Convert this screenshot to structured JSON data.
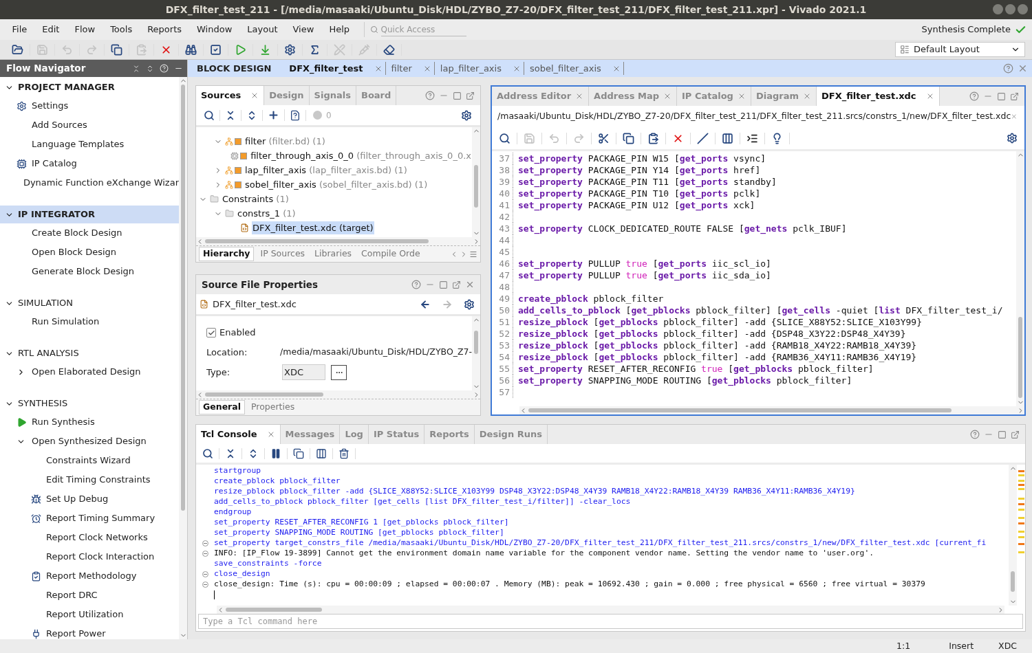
{
  "window": {
    "title": "DFX_filter_test_211 - [/media/masaaki/Ubuntu_Disk/HDL/ZYBO_Z7-20/DFX_filter_test_211/DFX_filter_test_211.xpr] - Vivado 2021.1"
  },
  "menu": [
    "File",
    "Edit",
    "Flow",
    "Tools",
    "Reports",
    "Window",
    "Layout",
    "View",
    "Help"
  ],
  "quick_access": {
    "placeholder": "Quick Access"
  },
  "status": {
    "text": "Synthesis Complete"
  },
  "layout_select": {
    "value": "Default Layout"
  },
  "toolbar": [
    {
      "kind": "open",
      "disabled": false
    },
    {
      "kind": "save",
      "disabled": true
    },
    {
      "kind": "undo",
      "disabled": true
    },
    {
      "kind": "redo",
      "disabled": true
    },
    {
      "kind": "copy",
      "disabled": false
    },
    {
      "kind": "paste",
      "disabled": true
    },
    {
      "kind": "delete",
      "disabled": false
    },
    {
      "kind": "find",
      "disabled": false
    },
    {
      "kind": "check",
      "disabled": false
    },
    {
      "kind": "run",
      "disabled": false
    },
    {
      "kind": "program",
      "disabled": false
    },
    {
      "kind": "settings",
      "disabled": false
    },
    {
      "kind": "sigma",
      "disabled": false
    },
    {
      "kind": "mark",
      "disabled": true
    },
    {
      "kind": "probe",
      "disabled": true
    },
    {
      "kind": "unmark",
      "disabled": false
    }
  ],
  "flow_navigator": {
    "title": "Flow Navigator",
    "sections": [
      {
        "label": "PROJECT MANAGER",
        "expanded": true,
        "selected": false,
        "bold": true,
        "items": [
          {
            "label": "Settings",
            "kind": "gear"
          },
          {
            "label": "Add Sources",
            "kind": "plain"
          },
          {
            "label": "Language Templates",
            "kind": "plain"
          },
          {
            "label": "IP Catalog",
            "kind": "ip"
          },
          {
            "label": "Dynamic Function eXchange Wizar",
            "kind": "plain"
          }
        ]
      },
      {
        "label": "IP INTEGRATOR",
        "expanded": true,
        "selected": true,
        "bold": true,
        "items": [
          {
            "label": "Create Block Design",
            "kind": "plain"
          },
          {
            "label": "Open Block Design",
            "kind": "plain"
          },
          {
            "label": "Generate Block Design",
            "kind": "plain"
          }
        ]
      },
      {
        "label": "SIMULATION",
        "expanded": true,
        "selected": false,
        "bold": false,
        "items": [
          {
            "label": "Run Simulation",
            "kind": "plain"
          }
        ]
      },
      {
        "label": "RTL ANALYSIS",
        "expanded": true,
        "selected": false,
        "bold": false,
        "items": [
          {
            "label": "Open Elaborated Design",
            "kind": "plain",
            "expanded": false
          }
        ]
      },
      {
        "label": "SYNTHESIS",
        "expanded": true,
        "selected": false,
        "bold": false,
        "items": [
          {
            "label": "Run Synthesis",
            "kind": "run"
          },
          {
            "label": "Open Synthesized Design",
            "kind": "plain",
            "expanded": true,
            "children": [
              {
                "label": "Constraints Wizard",
                "kind": "plain"
              },
              {
                "label": "Edit Timing Constraints",
                "kind": "plain"
              },
              {
                "label": "Set Up Debug",
                "kind": "debug"
              },
              {
                "label": "Report Timing Summary",
                "kind": "timer"
              },
              {
                "label": "Report Clock Networks",
                "kind": "plain"
              },
              {
                "label": "Report Clock Interaction",
                "kind": "plain"
              },
              {
                "label": "Report Methodology",
                "kind": "checklist"
              },
              {
                "label": "Report DRC",
                "kind": "plain"
              },
              {
                "label": "Report Utilization",
                "kind": "plain"
              },
              {
                "label": "Report Power",
                "kind": "power"
              }
            ]
          }
        ]
      }
    ]
  },
  "document": {
    "label": "BLOCK DESIGN",
    "tabs": [
      {
        "label": "DFX_filter_test",
        "selected": true
      },
      {
        "label": "filter",
        "selected": false
      },
      {
        "label": "lap_filter_axis",
        "selected": false
      },
      {
        "label": "sobel_filter_axis",
        "selected": false
      }
    ]
  },
  "sources": {
    "tabs": [
      {
        "label": "Sources",
        "selected": true
      },
      {
        "label": "Design",
        "selected": false
      },
      {
        "label": "Signals",
        "selected": false
      },
      {
        "label": "Board",
        "selected": false
      }
    ],
    "count": "0",
    "design_items": [
      {
        "name": "filter",
        "detail": "(filter.bd) (1)",
        "kind": "bd",
        "expanded": true,
        "selected": false,
        "children": [
          {
            "name": "filter_through_axis_0_0",
            "detail": "(filter_through_axis_0_0.x",
            "kind": "ip",
            "selected": false
          }
        ]
      },
      {
        "name": "lap_filter_axis",
        "detail": "(lap_filter_axis.bd) (1)",
        "kind": "bd",
        "expanded": false,
        "selected": false
      },
      {
        "name": "sobel_filter_axis",
        "detail": "(sobel_filter_axis.bd) (1)",
        "kind": "bd",
        "expanded": false,
        "selected": false
      }
    ],
    "tree": [
      {
        "name": "Constraints",
        "detail": "(1)",
        "kind": "folder",
        "expanded": true,
        "selected": false,
        "children": [
          {
            "name": "constrs_1",
            "detail": "(1)",
            "kind": "folder",
            "expanded": true,
            "selected": false,
            "children": [
              {
                "name": "DFX_filter_test.xdc (target)",
                "kind": "xdc",
                "selected": true
              }
            ]
          }
        ]
      }
    ],
    "bottom_tabs": [
      {
        "label": "Hierarchy",
        "selected": true
      },
      {
        "label": "IP Sources",
        "selected": false
      },
      {
        "label": "Libraries",
        "selected": false
      },
      {
        "label": "Compile Orde",
        "selected": false
      }
    ]
  },
  "properties": {
    "title": "Source File Properties",
    "file": "DFX_filter_test.xdc",
    "enabled": {
      "label": "Enabled",
      "checked": true
    },
    "location": {
      "label": "Location:",
      "value": "/media/masaaki/Ubuntu_Disk/HDL/ZYBO_Z7-"
    },
    "type": {
      "label": "Type:",
      "value": "XDC"
    },
    "bottom_tabs": [
      {
        "label": "General",
        "selected": true
      },
      {
        "label": "Properties",
        "selected": false
      }
    ]
  },
  "editor": {
    "tabs": [
      {
        "label": "Address Editor",
        "selected": false
      },
      {
        "label": "Address Map",
        "selected": false
      },
      {
        "label": "IP Catalog",
        "selected": false
      },
      {
        "label": "Diagram",
        "selected": false
      },
      {
        "label": "DFX_filter_test.xdc",
        "selected": true
      }
    ],
    "path": "/masaaki/Ubuntu_Disk/HDL/ZYBO_Z7-20/DFX_filter_test_211/DFX_filter_test_211.srcs/constrs_1/new/DFX_filter_test.xdc",
    "toolbar": [
      {
        "kind": "search",
        "disabled": false
      },
      {
        "kind": "save",
        "disabled": true
      },
      {
        "kind": "undo",
        "disabled": true
      },
      {
        "kind": "redo",
        "disabled": true
      },
      {
        "kind": "cut",
        "disabled": false
      },
      {
        "kind": "copy",
        "disabled": false
      },
      {
        "kind": "paste",
        "disabled": false
      },
      {
        "kind": "delete",
        "disabled": false
      },
      {
        "kind": "comment",
        "disabled": false
      },
      {
        "kind": "columns",
        "disabled": false
      },
      {
        "kind": "indent",
        "disabled": false
      },
      {
        "kind": "bulb",
        "disabled": false
      }
    ],
    "lines": [
      {
        "number": "37",
        "tokens": [
          {
            "kind": "keyword",
            "text": "set_property"
          },
          {
            "kind": "plain",
            "text": " PACKAGE_PIN W15 ["
          },
          {
            "kind": "keyword",
            "text": "get_ports"
          },
          {
            "kind": "plain",
            "text": " vsync]"
          }
        ]
      },
      {
        "number": "38",
        "tokens": [
          {
            "kind": "keyword",
            "text": "set_property"
          },
          {
            "kind": "plain",
            "text": " PACKAGE_PIN Y14 ["
          },
          {
            "kind": "keyword",
            "text": "get_ports"
          },
          {
            "kind": "plain",
            "text": " href]"
          }
        ]
      },
      {
        "number": "39",
        "tokens": [
          {
            "kind": "keyword",
            "text": "set_property"
          },
          {
            "kind": "plain",
            "text": " PACKAGE_PIN T11 ["
          },
          {
            "kind": "keyword",
            "text": "get_ports"
          },
          {
            "kind": "plain",
            "text": " standby]"
          }
        ]
      },
      {
        "number": "40",
        "tokens": [
          {
            "kind": "keyword",
            "text": "set_property"
          },
          {
            "kind": "plain",
            "text": " PACKAGE_PIN T10 ["
          },
          {
            "kind": "keyword",
            "text": "get_ports"
          },
          {
            "kind": "plain",
            "text": " pclk]"
          }
        ]
      },
      {
        "number": "41",
        "tokens": [
          {
            "kind": "keyword",
            "text": "set_property"
          },
          {
            "kind": "plain",
            "text": " PACKAGE_PIN U12 ["
          },
          {
            "kind": "keyword",
            "text": "get_ports"
          },
          {
            "kind": "plain",
            "text": " xck]"
          }
        ]
      },
      {
        "number": "42"
      },
      {
        "number": "43",
        "tokens": [
          {
            "kind": "keyword",
            "text": "set_property"
          },
          {
            "kind": "plain",
            "text": " CLOCK_DEDICATED_ROUTE FALSE ["
          },
          {
            "kind": "keyword",
            "text": "get_nets"
          },
          {
            "kind": "plain",
            "text": " pclk_IBUF]"
          }
        ]
      },
      {
        "number": "44"
      },
      {
        "number": "45"
      },
      {
        "number": "46",
        "tokens": [
          {
            "kind": "keyword",
            "text": "set_property"
          },
          {
            "kind": "plain",
            "text": " PULLUP "
          },
          {
            "kind": "literal",
            "text": "true"
          },
          {
            "kind": "plain",
            "text": " ["
          },
          {
            "kind": "keyword",
            "text": "get_ports"
          },
          {
            "kind": "plain",
            "text": " iic_scl_io]"
          }
        ]
      },
      {
        "number": "47",
        "tokens": [
          {
            "kind": "keyword",
            "text": "set_property"
          },
          {
            "kind": "plain",
            "text": " PULLUP "
          },
          {
            "kind": "literal",
            "text": "true"
          },
          {
            "kind": "plain",
            "text": " ["
          },
          {
            "kind": "keyword",
            "text": "get_ports"
          },
          {
            "kind": "plain",
            "text": " iic_sda_io]"
          }
        ]
      },
      {
        "number": "48"
      },
      {
        "number": "49",
        "tokens": [
          {
            "kind": "keyword",
            "text": "create_pblock"
          },
          {
            "kind": "plain",
            "text": " pblock_filter"
          }
        ]
      },
      {
        "number": "50",
        "tokens": [
          {
            "kind": "keyword",
            "text": "add_cells_to_pblock"
          },
          {
            "kind": "plain",
            "text": " ["
          },
          {
            "kind": "keyword",
            "text": "get_pblocks"
          },
          {
            "kind": "plain",
            "text": " pblock_filter] ["
          },
          {
            "kind": "keyword",
            "text": "get_cells"
          },
          {
            "kind": "plain",
            "text": " -quiet ["
          },
          {
            "kind": "keyword",
            "text": "list"
          },
          {
            "kind": "plain",
            "text": " DFX_filter_test_i/"
          }
        ]
      },
      {
        "number": "51",
        "tokens": [
          {
            "kind": "keyword",
            "text": "resize_pblock"
          },
          {
            "kind": "plain",
            "text": " ["
          },
          {
            "kind": "keyword",
            "text": "get_pblocks"
          },
          {
            "kind": "plain",
            "text": " pblock_filter] -add {SLICE_X88Y52:SLICE_X103Y99}"
          }
        ]
      },
      {
        "number": "52",
        "tokens": [
          {
            "kind": "keyword",
            "text": "resize_pblock"
          },
          {
            "kind": "plain",
            "text": " ["
          },
          {
            "kind": "keyword",
            "text": "get_pblocks"
          },
          {
            "kind": "plain",
            "text": " pblock_filter] -add {DSP48_X3Y22:DSP48_X4Y39}"
          }
        ]
      },
      {
        "number": "53",
        "tokens": [
          {
            "kind": "keyword",
            "text": "resize_pblock"
          },
          {
            "kind": "plain",
            "text": " ["
          },
          {
            "kind": "keyword",
            "text": "get_pblocks"
          },
          {
            "kind": "plain",
            "text": " pblock_filter] -add {RAMB18_X4Y22:RAMB18_X4Y39}"
          }
        ]
      },
      {
        "number": "54",
        "tokens": [
          {
            "kind": "keyword",
            "text": "resize_pblock"
          },
          {
            "kind": "plain",
            "text": " ["
          },
          {
            "kind": "keyword",
            "text": "get_pblocks"
          },
          {
            "kind": "plain",
            "text": " pblock_filter] -add {RAMB36_X4Y11:RAMB36_X4Y19}"
          }
        ]
      },
      {
        "number": "55",
        "tokens": [
          {
            "kind": "keyword",
            "text": "set_property"
          },
          {
            "kind": "plain",
            "text": " RESET_AFTER_RECONFIG "
          },
          {
            "kind": "literal",
            "text": "true"
          },
          {
            "kind": "plain",
            "text": " ["
          },
          {
            "kind": "keyword",
            "text": "get_pblocks"
          },
          {
            "kind": "plain",
            "text": " pblock_filter]"
          }
        ]
      },
      {
        "number": "56",
        "tokens": [
          {
            "kind": "keyword",
            "text": "set_property"
          },
          {
            "kind": "plain",
            "text": " SNAPPING_MODE ROUTING ["
          },
          {
            "kind": "keyword",
            "text": "get_pblocks"
          },
          {
            "kind": "plain",
            "text": " pblock_filter]"
          }
        ]
      },
      {
        "number": "57"
      }
    ]
  },
  "console": {
    "tabs": [
      {
        "label": "Tcl Console",
        "selected": true
      },
      {
        "label": "Messages",
        "selected": false
      },
      {
        "label": "Log",
        "selected": false
      },
      {
        "label": "IP Status",
        "selected": false
      },
      {
        "label": "Reports",
        "selected": false
      },
      {
        "label": "Design Runs",
        "selected": false
      }
    ],
    "lines": [
      {
        "text": "startgroup",
        "kind": "command",
        "fold": false
      },
      {
        "text": "create_pblock pblock_filter",
        "kind": "command",
        "fold": false
      },
      {
        "text": "resize_pblock pblock_filter -add {SLICE_X88Y52:SLICE_X103Y99 DSP48_X3Y22:DSP48_X4Y39 RAMB18_X4Y22:RAMB18_X4Y39 RAMB36_X4Y11:RAMB36_X4Y19}",
        "kind": "command",
        "fold": false
      },
      {
        "text": "add_cells_to_pblock pblock_filter [get_cells [list DFX_filter_test_i/filter]] -clear_locs",
        "kind": "command",
        "fold": false
      },
      {
        "text": "endgroup",
        "kind": "command",
        "fold": false
      },
      {
        "text": "set_property RESET_AFTER_RECONFIG 1 [get_pblocks pblock_filter]",
        "kind": "command",
        "fold": false
      },
      {
        "text": "set_property SNAPPING_MODE ROUTING [get_pblocks pblock_filter]",
        "kind": "command",
        "fold": false
      },
      {
        "text": "set_property target_constrs_file /media/masaaki/Ubuntu_Disk/HDL/ZYBO_Z7-20/DFX_filter_test_211/DFX_filter_test_211.srcs/constrs_1/new/DFX_filter_test.xdc [current_fi",
        "kind": "command",
        "fold": true
      },
      {
        "text": "INFO: [IP_Flow 19-3899] Cannot get the environment domain name variable for the component vendor name. Setting the vendor name to 'user.org'.",
        "kind": "output",
        "fold": true
      },
      {
        "text": "save_constraints -force",
        "kind": "command",
        "fold": false
      },
      {
        "text": "close_design",
        "kind": "command",
        "fold": true
      },
      {
        "text": "close_design: Time (s): cpu = 00:00:09 ; elapsed = 00:00:07 . Memory (MB): peak = 10692.430 ; gain = 0.000 ; free physical = 6560 ; free virtual = 30379",
        "kind": "output",
        "fold": true
      }
    ],
    "input": {
      "placeholder": "Type a Tcl command here"
    }
  },
  "status_bar": {
    "position": "1:1",
    "mode": "Insert",
    "file_type": "XDC"
  }
}
